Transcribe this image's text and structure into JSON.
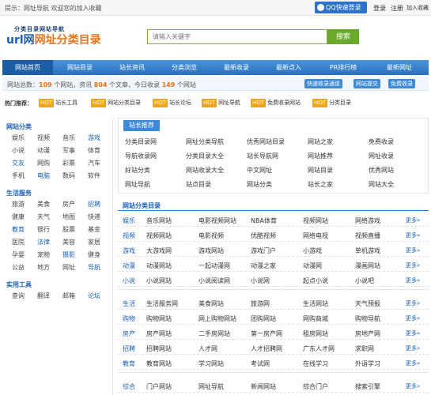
{
  "topbar": {
    "notice": "提示：网址导航 欢迎您的加入收藏",
    "login_label": "QQ快速登录",
    "links": [
      "登录",
      "注册",
      "加入收藏"
    ]
  },
  "header": {
    "logo_small": "分类目录网站导航",
    "logo_prefix": "url网",
    "logo_big": "网址分类目录",
    "search_placeholder": "请输入关键字",
    "search_button": "搜索"
  },
  "nav": [
    "网站首页",
    "网站目录",
    "站长资讯",
    "分类浏览",
    "最新收录",
    "最新点入",
    "PR排行榜",
    "最新网址"
  ],
  "stats": {
    "prefix": "网站总数：",
    "sites": "109",
    "mid1": " 个网站，资讯 ",
    "articles": "804",
    "mid2": " 个文章，今日收录 ",
    "today": "149",
    "suffix": " 个网站",
    "buttons": [
      "快速收录通道",
      "网站提交",
      "免费收录"
    ]
  },
  "hot": {
    "label": "热门推荐：",
    "chips": [
      {
        "tag": "HOT",
        "text": "站长工具"
      },
      {
        "tag": "HOT",
        "text": "网站分类目录"
      },
      {
        "tag": "HOT",
        "text": "站长论坛"
      },
      {
        "tag": "HOT",
        "text": "网址导航"
      },
      {
        "tag": "HOT",
        "text": "免费收录网站"
      },
      {
        "tag": "HOT",
        "text": "分类目录"
      }
    ]
  },
  "sidebar": {
    "sections": [
      {
        "title": "网站分类",
        "items": [
          "娱乐",
          "视频",
          "音乐",
          "游戏",
          "小说",
          "动漫",
          "军事",
          "体育",
          "交友",
          "网购",
          "彩票",
          "汽车",
          "手机",
          "电脑",
          "数码",
          "软件"
        ]
      },
      {
        "title": "生活服务",
        "items": [
          "旅游",
          "美食",
          "房产",
          "招聘",
          "健康",
          "天气",
          "地图",
          "快递",
          "教育",
          "银行",
          "股票",
          "基金",
          "医院",
          "法律",
          "美容",
          "家居",
          "孕婴",
          "宠物",
          "摄影",
          "健身",
          "公益",
          "地方",
          "网址",
          "导航"
        ]
      },
      {
        "title": "实用工具",
        "items": [
          "查询",
          "翻译",
          "邮箱",
          "论坛"
        ]
      }
    ]
  },
  "recommend": {
    "tab": "站长推荐",
    "items": [
      "分类目录网",
      "网址分类导航",
      "优秀网站目录",
      "网站之家",
      "免费收录",
      "导航收录网",
      "分类目录大全",
      "站长导航网",
      "网站推荐",
      "网址收录",
      "好站分类",
      "网站收录大全",
      "中文网址",
      "网站目录",
      "优秀网站",
      "网址导航",
      "站点目录",
      "网站分类",
      "站长之家",
      "网站大全"
    ]
  },
  "categories": {
    "title": "网站分类目录",
    "groups": [
      {
        "rows": [
          {
            "cat": "娱乐",
            "sites": [
              "音乐网站",
              "电影视频网站",
              "NBA体育",
              "视频网站",
              "网络游戏"
            ]
          },
          {
            "cat": "视频",
            "sites": [
              "视频网站",
              "电影视频",
              "优酷视频",
              "网络电视",
              "视频直播"
            ]
          },
          {
            "cat": "游戏",
            "sites": [
              "大游戏网",
              "游戏网站",
              "游戏门户",
              "小游戏",
              "单机游戏"
            ]
          },
          {
            "cat": "动漫",
            "sites": [
              "动漫网站",
              "一起动漫网",
              "动漫之家",
              "动漫网",
              "漫画网站"
            ]
          },
          {
            "cat": "小说",
            "sites": [
              "小说网站",
              "小说阅读网",
              "小说网",
              "起点小说",
              "小说吧"
            ]
          }
        ]
      },
      {
        "rows": [
          {
            "cat": "生活",
            "sites": [
              "生活服务网",
              "美食网站",
              "旅游网",
              "生活网站",
              "天气预报"
            ]
          },
          {
            "cat": "购物",
            "sites": [
              "购物网站",
              "网上购物网站",
              "团购网站",
              "网购商城",
              "购物导航"
            ]
          },
          {
            "cat": "房产",
            "sites": [
              "房产网站",
              "二手房网站",
              "第一房产网",
              "租房网站",
              "房地产网"
            ]
          },
          {
            "cat": "招聘",
            "sites": [
              "招聘网站",
              "人才网",
              "人才招聘网",
              "广东人才网",
              "求职网"
            ]
          },
          {
            "cat": "教育",
            "sites": [
              "教育网站",
              "学习网站",
              "考试网",
              "在线学习",
              "外语学习"
            ]
          }
        ]
      },
      {
        "rows": [
          {
            "cat": "综合",
            "sites": [
              "门户网站",
              "网址导航",
              "新闻网站",
              "综合门户",
              "搜索引擎"
            ]
          }
        ]
      }
    ],
    "more_label": "更多»"
  }
}
